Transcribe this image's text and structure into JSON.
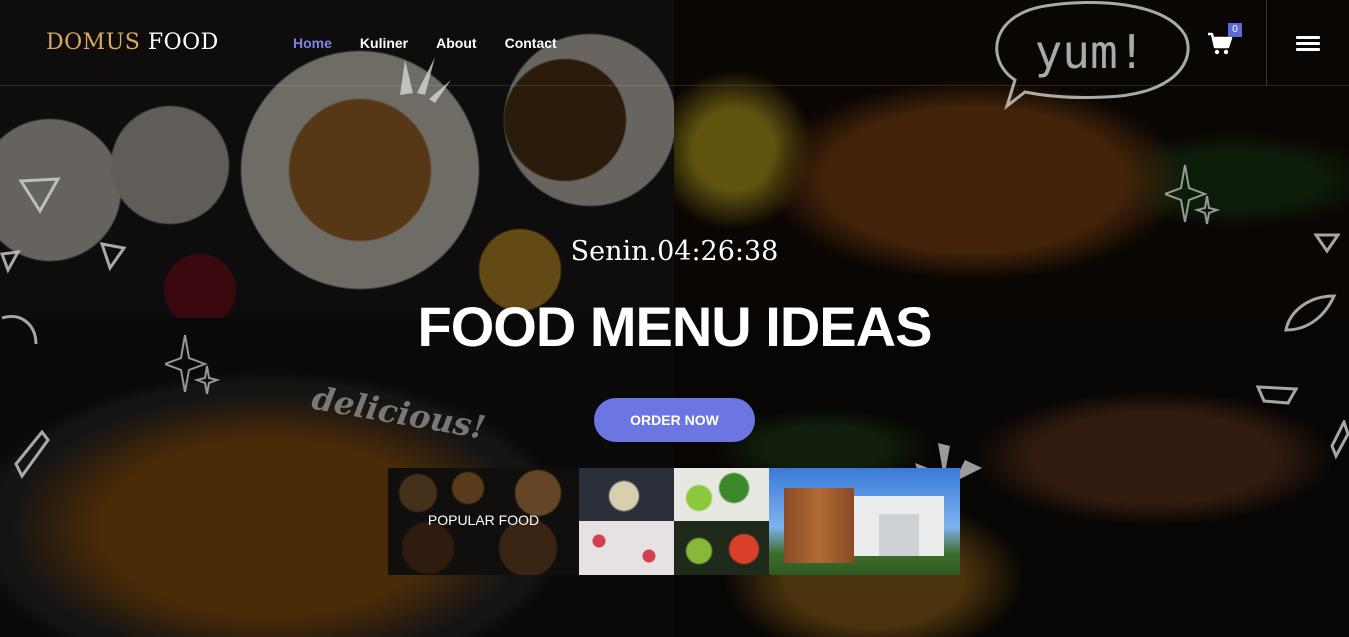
{
  "logo": {
    "part1": "DOMUS",
    "part2": "FOOD"
  },
  "nav": {
    "home": "Home",
    "kuliner": "Kuliner",
    "about": "About",
    "contact": "Contact"
  },
  "cart": {
    "count": "0",
    "icon": "cart-icon"
  },
  "menu": {
    "icon": "hamburger-menu-icon"
  },
  "doodles": {
    "speech": "yum!",
    "script": "delicious!"
  },
  "hero": {
    "clock": "Senin.04:26:38",
    "title": "FOOD MENU IDEAS",
    "cta": "ORDER NOW"
  },
  "gallery": {
    "popular_caption": "POPULAR FOOD"
  },
  "colors": {
    "accent": "#6c76e2",
    "active_nav": "#7b85e4",
    "logo_gold": "#d8aa5c",
    "badge": "#5b6ad6"
  }
}
